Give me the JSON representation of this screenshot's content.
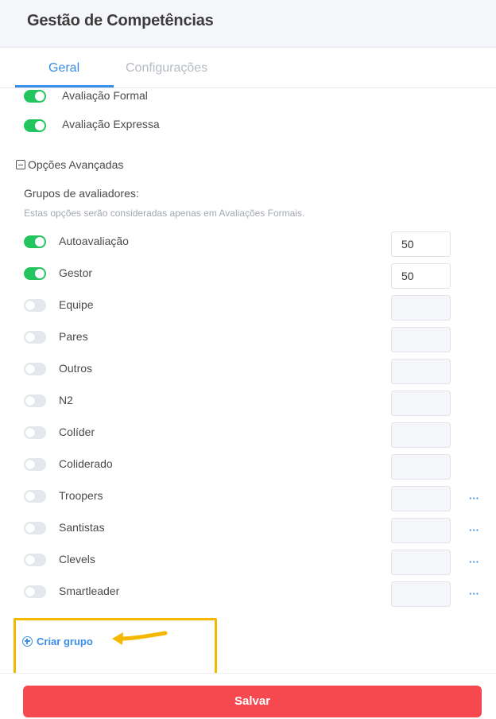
{
  "header": {
    "title": "Gestão de Competências"
  },
  "tabs": [
    {
      "label": "Geral",
      "active": true
    },
    {
      "label": "Configurações",
      "active": false
    }
  ],
  "evaluation_types": [
    {
      "label": "Avaliação Formal",
      "enabled": true
    },
    {
      "label": "Avaliação Expressa",
      "enabled": true
    }
  ],
  "advanced": {
    "toggle_label": "Opções Avançadas",
    "expanded": true,
    "groups_title": "Grupos de avaliadores:",
    "groups_hint": "Estas opções serão consideradas apenas em Avaliações Formais."
  },
  "evaluator_groups": [
    {
      "label": "Autoavaliação",
      "enabled": true,
      "weight": "50",
      "has_menu": false
    },
    {
      "label": "Gestor",
      "enabled": true,
      "weight": "50",
      "has_menu": false
    },
    {
      "label": "Equipe",
      "enabled": false,
      "weight": "",
      "has_menu": false
    },
    {
      "label": "Pares",
      "enabled": false,
      "weight": "",
      "has_menu": false
    },
    {
      "label": "Outros",
      "enabled": false,
      "weight": "",
      "has_menu": false
    },
    {
      "label": "N2",
      "enabled": false,
      "weight": "",
      "has_menu": false
    },
    {
      "label": "Colíder",
      "enabled": false,
      "weight": "",
      "has_menu": false
    },
    {
      "label": "Coliderado",
      "enabled": false,
      "weight": "",
      "has_menu": false
    },
    {
      "label": "Troopers",
      "enabled": false,
      "weight": "",
      "has_menu": true
    },
    {
      "label": "Santistas",
      "enabled": false,
      "weight": "",
      "has_menu": true
    },
    {
      "label": "Clevels",
      "enabled": false,
      "weight": "",
      "has_menu": true
    },
    {
      "label": "Smartleader",
      "enabled": false,
      "weight": "",
      "has_menu": true
    }
  ],
  "more_glyph": "···",
  "create_group_label": "Criar grupo",
  "save_label": "Salvar",
  "colors": {
    "accent": "#3a8ee6",
    "toggle_on": "#22c55e",
    "save": "#f5484f",
    "highlight": "#f5b800"
  }
}
